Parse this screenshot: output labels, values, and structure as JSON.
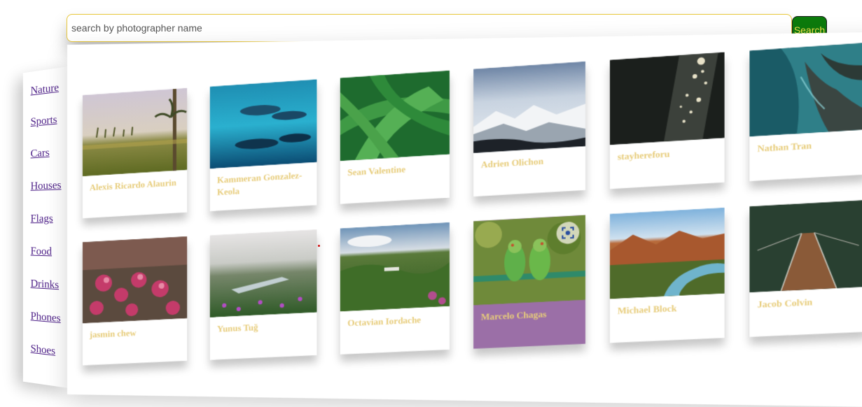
{
  "search": {
    "placeholder": "search by photographer name",
    "value": "",
    "button_label": "Search"
  },
  "sidebar": {
    "items": [
      {
        "label": "Nature"
      },
      {
        "label": "Sports"
      },
      {
        "label": "Cars"
      },
      {
        "label": "Houses"
      },
      {
        "label": "Flags"
      },
      {
        "label": "Food"
      },
      {
        "label": "Drinks"
      },
      {
        "label": "Phones"
      },
      {
        "label": "Shoes"
      }
    ]
  },
  "gallery": {
    "cards": [
      {
        "photographer": "Alexis Ricardo Alaurin",
        "photo": "palm-trees-field"
      },
      {
        "photographer": "Kammeran Gonzalez-Keola",
        "photo": "dolphins-underwater"
      },
      {
        "photographer": "Sean Valentine",
        "photo": "green-leaves"
      },
      {
        "photographer": "Adrien Olichon",
        "photo": "snowy-mountains"
      },
      {
        "photographer": "stayhereforu",
        "photo": "sunlit-water"
      },
      {
        "photographer": "Nathan Tran",
        "photo": "aerial-coast"
      },
      {
        "photographer": "jasmin chew",
        "photo": "pink-flowers"
      },
      {
        "photographer": "Yunus Tuğ",
        "photo": "valley-lake-flowers"
      },
      {
        "photographer": "Octavian Iordache",
        "photo": "green-hills"
      },
      {
        "photographer": "Marcelo Chagas",
        "photo": "parrots",
        "highlighted": true
      },
      {
        "photographer": "Michael Block",
        "photo": "canyon-river"
      },
      {
        "photographer": "Jacob Colvin",
        "photo": "forest-bridge"
      }
    ]
  },
  "colors": {
    "search_border": "#e8c73a",
    "search_button_bg": "#0b7a0b",
    "search_button_text": "#f2e14a",
    "sidebar_link": "#4b1d86",
    "caption_text": "#e7cc7a",
    "highlight_card": "#9b6fa7"
  },
  "icons": {
    "card_lens": "visual-search-icon"
  }
}
